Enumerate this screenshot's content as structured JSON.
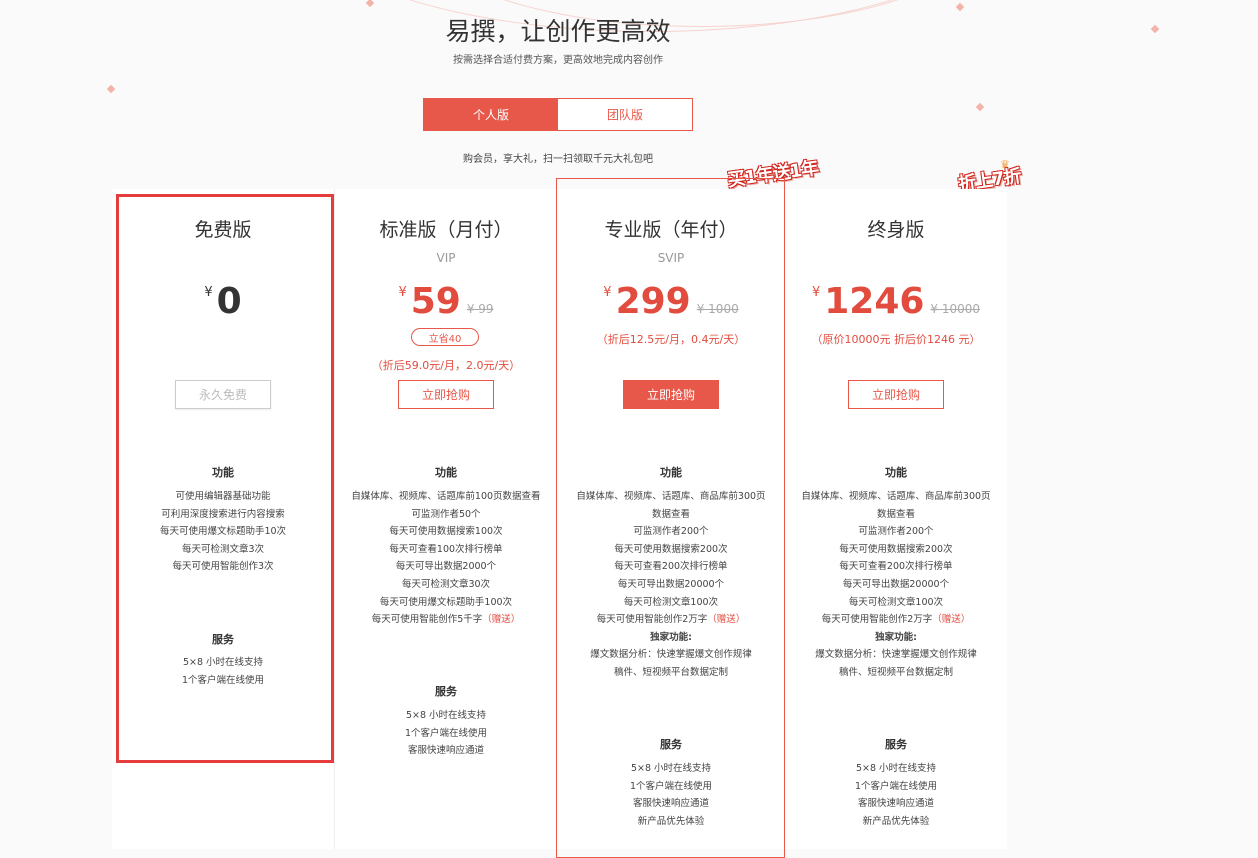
{
  "header": {
    "title": "易撰，让创作更高效",
    "subtitle": "按需选择合适付费方案，更高效地完成内容创作"
  },
  "tabs": [
    {
      "label": "个人版",
      "active": true
    },
    {
      "label": "团队版",
      "active": false
    }
  ],
  "promo_text": "购会员，享大礼，扫一扫领取千元大礼包吧",
  "ribbons": {
    "pro": "买1年送1年",
    "lifetime": "折上7折"
  },
  "plans": [
    {
      "name": "免费版",
      "currency": "¥",
      "price": "0",
      "button": "永久免费",
      "features_title": "功能",
      "features": [
        "可使用编辑器基础功能",
        "可利用深度搜索进行内容搜索",
        "每天可使用爆文标题助手10次",
        "每天可检测文章3次",
        "每天可使用智能创作3次"
      ],
      "service_title": "服务",
      "services": [
        "5×8 小时在线支持",
        "1个客户端在线使用"
      ]
    },
    {
      "name": "标准版（月付）",
      "tier": "VIP",
      "currency": "¥",
      "price": "59",
      "original_price": "¥ 99",
      "save_badge": "立省40",
      "note": "（折后59.0元/月，2.0元/天）",
      "button": "立即抢购",
      "features_title": "功能",
      "features": [
        "自媒体库、视频库、话题库前100页数据查看",
        "可监测作者50个",
        "每天可使用数据搜索100次",
        "每天可查看100次排行榜单",
        "每天可导出数据2000个",
        "每天可检测文章30次",
        "每天可使用爆文标题助手100次",
        "每天可使用智能创作5千字"
      ],
      "gift": "（赠送）",
      "service_title": "服务",
      "services": [
        "5×8 小时在线支持",
        "1个客户端在线使用",
        "客服快速响应通道"
      ]
    },
    {
      "name": "专业版（年付）",
      "tier": "SVIP",
      "currency": "¥",
      "price": "299",
      "original_price": "¥ 1000",
      "note": "（折后12.5元/月，0.4元/天）",
      "button": "立即抢购",
      "features_title": "功能",
      "features": [
        "自媒体库、视频库、话题库、商品库前300页",
        "数据查看",
        "可监测作者200个",
        "每天可使用数据搜索200次",
        "每天可查看200次排行榜单",
        "每天可导出数据20000个",
        "每天可检测文章100次",
        "每天可使用智能创作2万字"
      ],
      "gift": "（赠送）",
      "exclusive_title": "独家功能:",
      "exclusive": [
        "爆文数据分析：快速掌握爆文创作规律",
        "稿件、短视频平台数据定制"
      ],
      "service_title": "服务",
      "services": [
        "5×8 小时在线支持",
        "1个客户端在线使用",
        "客服快速响应通道",
        "新产品优先体验"
      ]
    },
    {
      "name": "终身版",
      "currency": "¥",
      "price": "1246",
      "original_price": "¥ 10000",
      "note": "（原价10000元 折后价1246 元）",
      "button": "立即抢购",
      "features_title": "功能",
      "features": [
        "自媒体库、视频库、话题库、商品库前300页",
        "数据查看",
        "可监测作者200个",
        "每天可使用数据搜索200次",
        "每天可查看200次排行榜单",
        "每天可导出数据20000个",
        "每天可检测文章100次",
        "每天可使用智能创作2万字"
      ],
      "gift": "（赠送）",
      "exclusive_title": "独家功能:",
      "exclusive": [
        "爆文数据分析：快速掌握爆文创作规律",
        "稿件、短视频平台数据定制"
      ],
      "service_title": "服务",
      "services": [
        "5×8 小时在线支持",
        "1个客户端在线使用",
        "客服快速响应通道",
        "新产品优先体验"
      ]
    }
  ],
  "colors": {
    "accent": "#e8584a",
    "price_red": "#e24c3e",
    "highlight_border": "#e53d3d"
  }
}
